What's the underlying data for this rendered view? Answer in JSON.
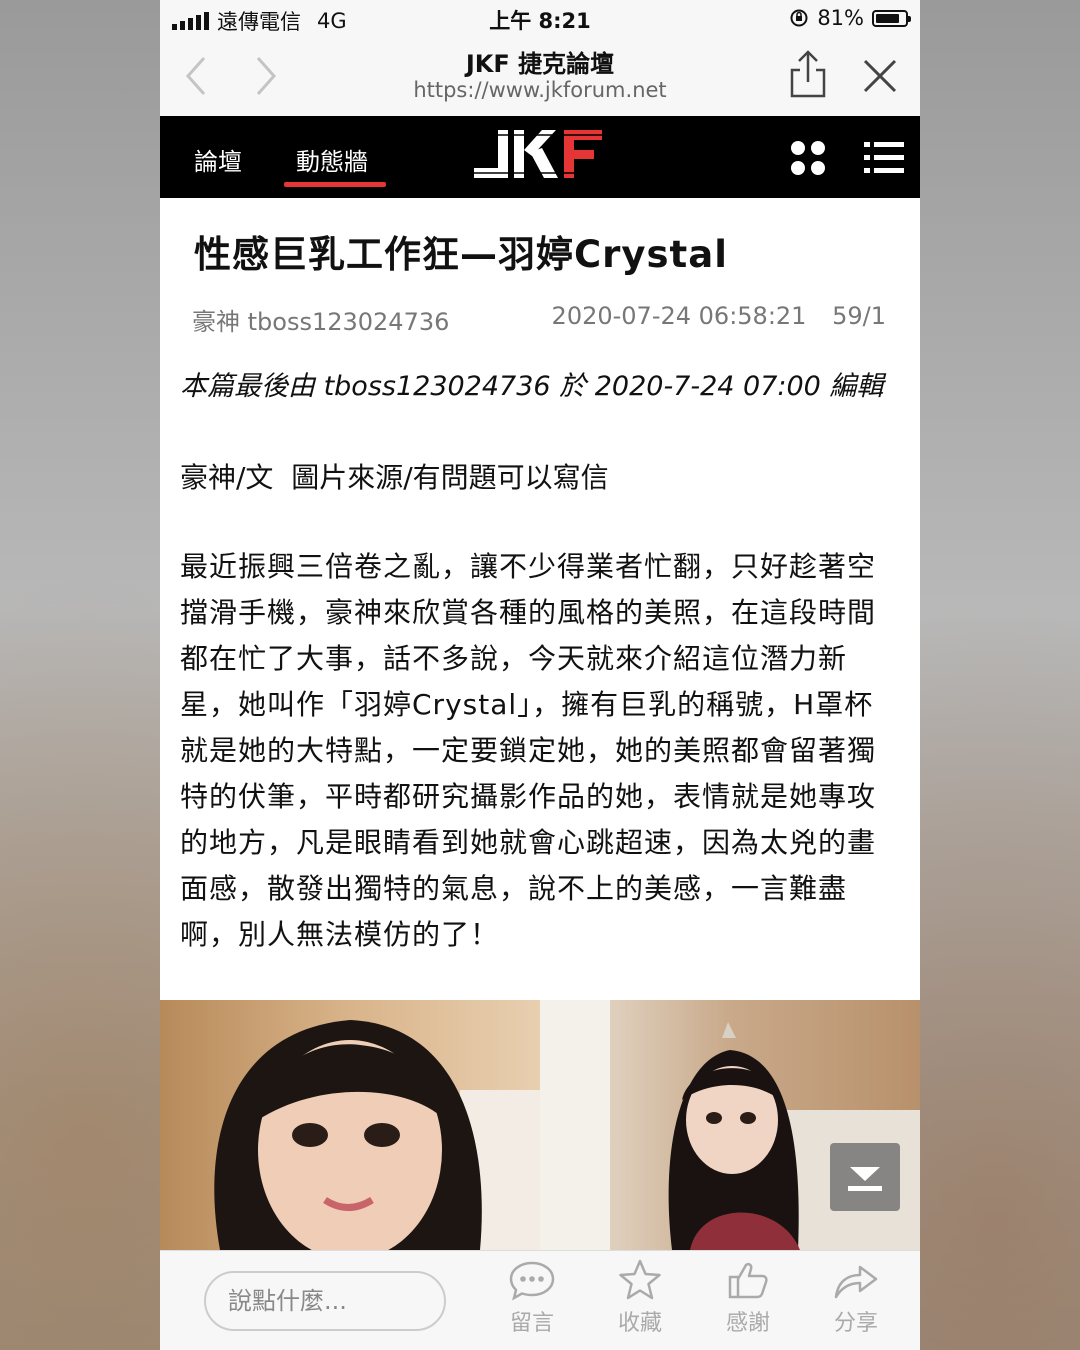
{
  "status_bar": {
    "carrier": "遠傳電信",
    "network": "4G",
    "time": "上午 8:21",
    "battery_percent": "81%",
    "battery_level": 0.81
  },
  "browser": {
    "back_icon": "chevron-left-icon",
    "forward_icon": "chevron-right-icon",
    "title": "JKF 捷克論壇",
    "url": "https://www.jkforum.net",
    "share_icon": "share-icon",
    "close_icon": "close-icon"
  },
  "header": {
    "tabs": [
      {
        "label": "論壇",
        "active": false
      },
      {
        "label": "動態牆",
        "active": true
      }
    ],
    "logo_text": "JKF",
    "accent_color": "#e53535",
    "grid_icon": "four-dots-icon",
    "menu_icon": "hamburger-menu-icon"
  },
  "post": {
    "title": "性感巨乳工作狂—羽婷Crystal",
    "author": "豪神 tboss123024736",
    "datetime": "2020-07-24 06:58:21",
    "stats": "59/1",
    "edit_note": "本篇最後由 tboss123024736 於 2020-7-24 07:00 編輯",
    "byline": "豪神/文  圖片來源/有問題可以寫信",
    "body": "最近振興三倍卷之亂，讓不少得業者忙翻，只好趁著空擋滑手機，豪神來欣賞各種的風格的美照，在這段時間都在忙了大事，話不多說，今天就來介紹這位潛力新星，她叫作「羽婷Crystal」，擁有巨乳的稱號，H罩杯就是她的大特點，一定要鎖定她，她的美照都會留著獨特的伏筆，平時都研究攝影作品的她，表情就是她專攻的地方，凡是眼睛看到她就會心跳超速，因為太兇的畫面感，散發出獨特的氣息，說不上的美感，一言難盡啊，別人無法模仿的了！"
  },
  "bottom_bar": {
    "comment_placeholder": "說點什麼...",
    "actions": [
      {
        "label": "留言",
        "icon": "speech-bubble-icon"
      },
      {
        "label": "收藏",
        "icon": "star-icon"
      },
      {
        "label": "感謝",
        "icon": "thumbs-up-icon"
      },
      {
        "label": "分享",
        "icon": "share-arrow-icon"
      }
    ]
  }
}
